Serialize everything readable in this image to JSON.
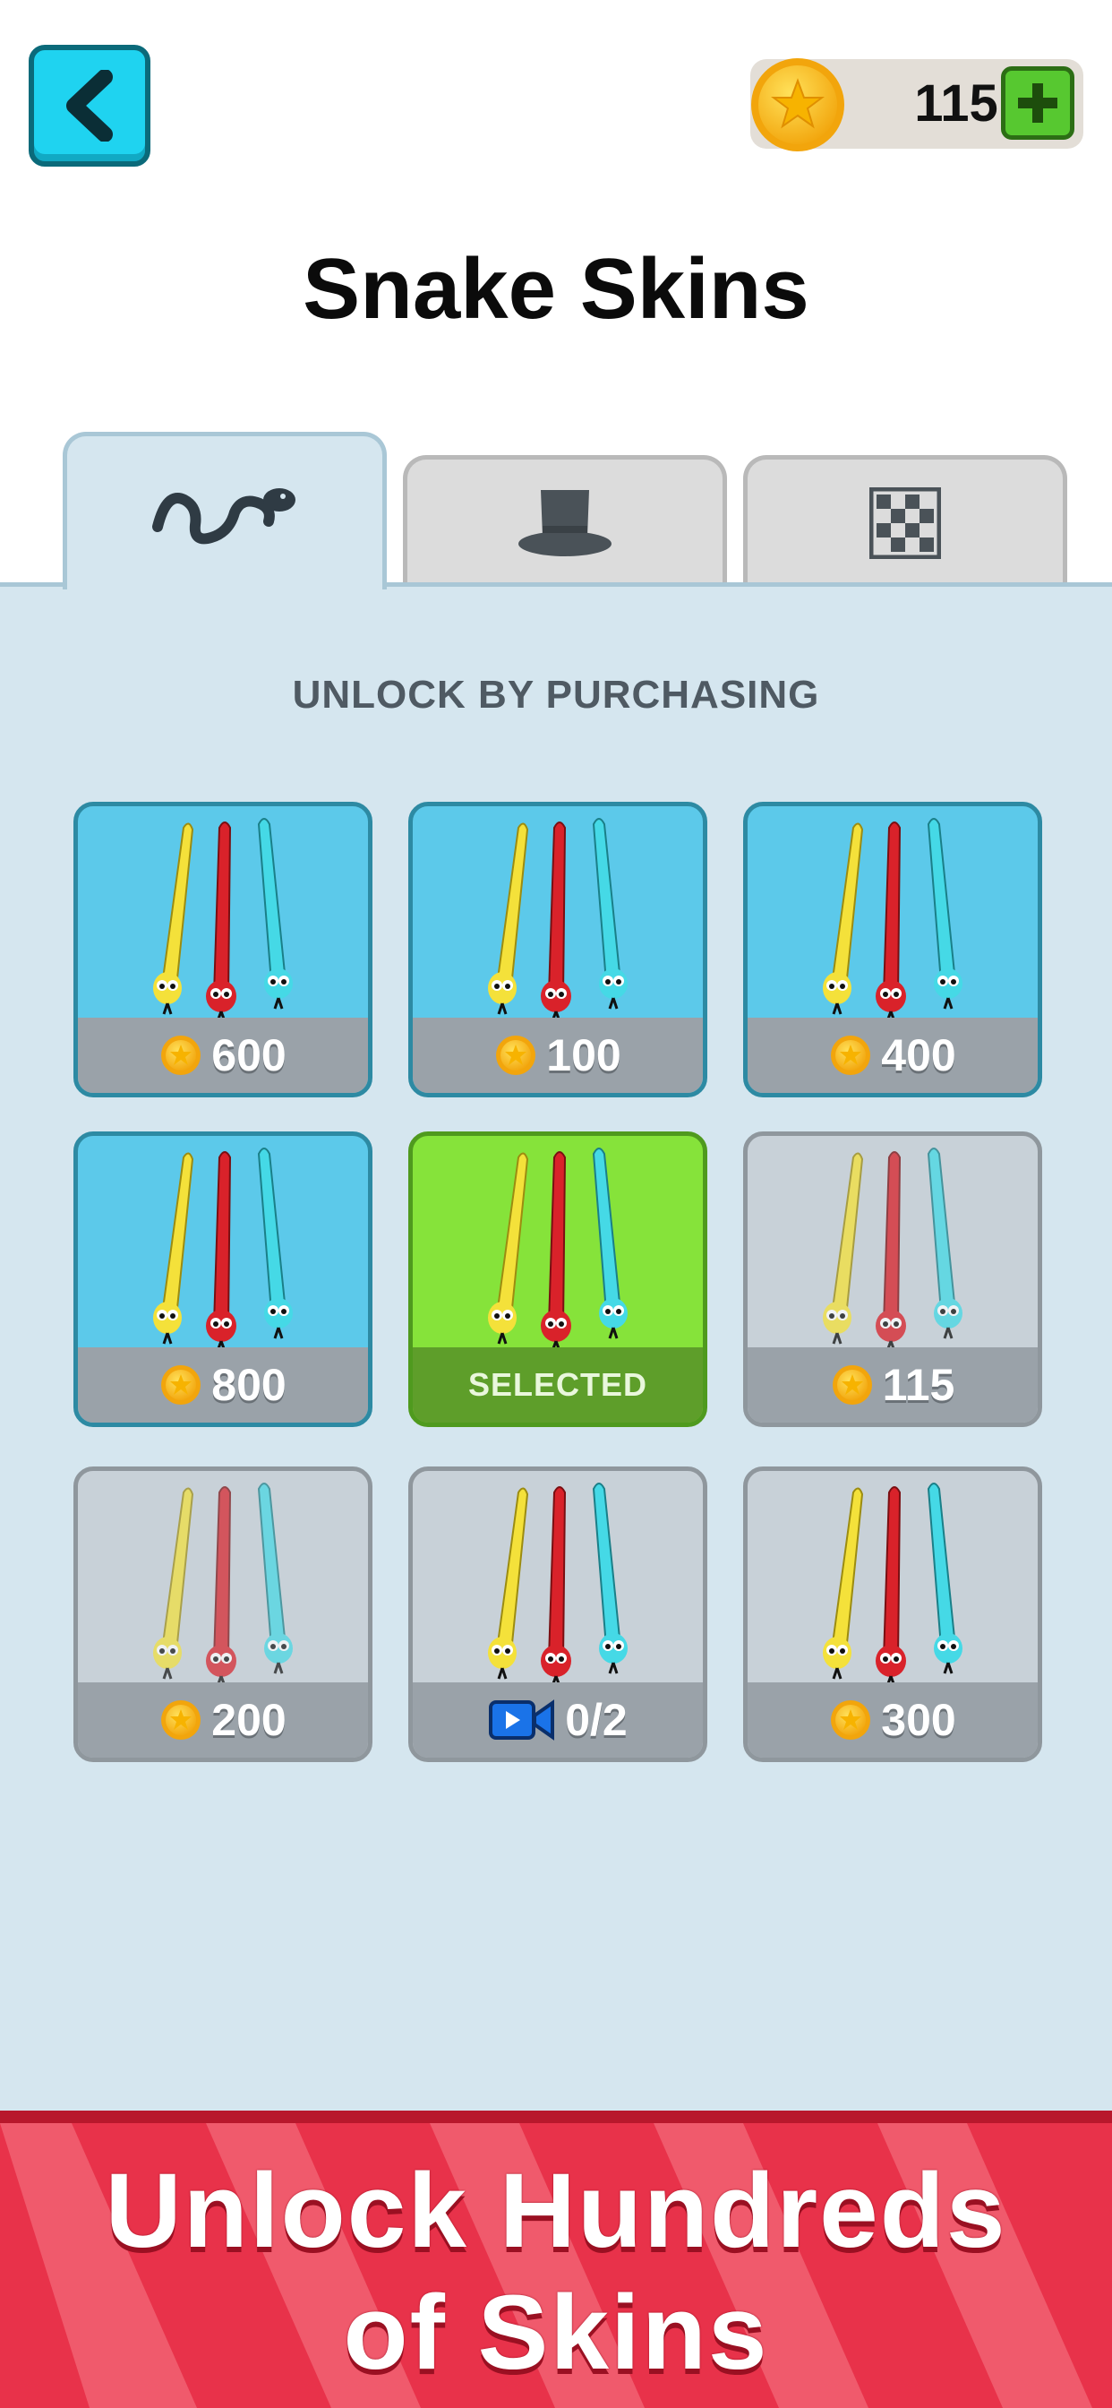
{
  "header": {
    "coins": "115",
    "title": "Snake Skins"
  },
  "tabs": [
    {
      "icon": "snake-icon",
      "active": true
    },
    {
      "icon": "top-hat-icon",
      "active": false
    },
    {
      "icon": "checker-pattern-icon",
      "active": false
    }
  ],
  "section": {
    "label": "UNLOCK BY PURCHASING"
  },
  "skins": [
    {
      "price": "600",
      "state": "purchasable"
    },
    {
      "price": "100",
      "state": "purchasable"
    },
    {
      "price": "400",
      "state": "purchasable"
    },
    {
      "price": "800",
      "state": "purchasable"
    },
    {
      "label": "SELECTED",
      "state": "selected"
    },
    {
      "price": "115",
      "state": "locked"
    },
    {
      "price": "200",
      "state": "locked"
    },
    {
      "video_progress": "0/2",
      "state": "locked"
    },
    {
      "price": "300",
      "state": "locked"
    }
  ],
  "banner": {
    "line1": "Unlock Hundreds",
    "line2": "of Skins"
  },
  "colors": {
    "accent": "#1fd3f0",
    "panel": "#d5e6ef",
    "card_blue": "#5cc9ea",
    "card_selected": "#86e33a",
    "card_locked": "#c8d1d8",
    "banner": "#e8324a",
    "snake_yellow": "#f4e13a",
    "snake_red": "#d9222a",
    "snake_cyan": "#45d9e6"
  }
}
